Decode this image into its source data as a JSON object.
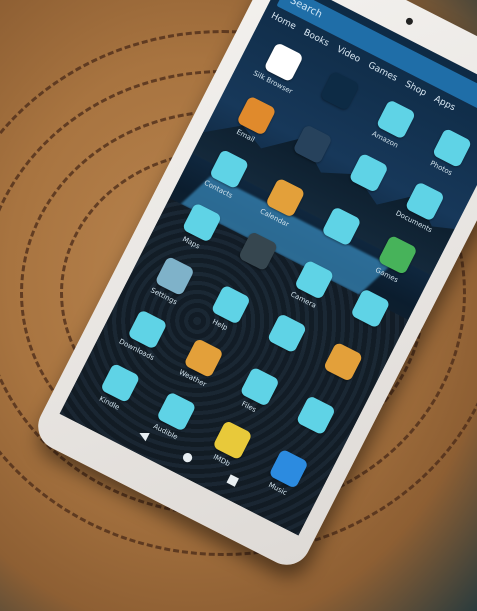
{
  "screen": {
    "search_placeholder": "Search",
    "tabs": [
      "Home",
      "Books",
      "Video",
      "Games",
      "Shop",
      "Apps"
    ],
    "apps": [
      {
        "label": "Silk Browser",
        "color": "#ffffff"
      },
      {
        "label": "",
        "color": "#0d2b45"
      },
      {
        "label": "Amazon",
        "color": "#5fd3e6"
      },
      {
        "label": "Photos",
        "color": "#5fd3e6"
      },
      {
        "label": "Email",
        "color": "#e08a2c"
      },
      {
        "label": "",
        "color": "#27425c"
      },
      {
        "label": "",
        "color": "#5fd3e6"
      },
      {
        "label": "Documents",
        "color": "#5fd3e6"
      },
      {
        "label": "Contacts",
        "color": "#5fd3e6"
      },
      {
        "label": "Calendar",
        "color": "#e3a03a"
      },
      {
        "label": "",
        "color": "#5fd3e6"
      },
      {
        "label": "Games",
        "color": "#47b35a"
      },
      {
        "label": "Maps",
        "color": "#5fd3e6"
      },
      {
        "label": "",
        "color": "#36464f"
      },
      {
        "label": "Camera",
        "color": "#5fd3e6"
      },
      {
        "label": "",
        "color": "#5fd3e6"
      },
      {
        "label": "Settings",
        "color": "#7fb2c9"
      },
      {
        "label": "Help",
        "color": "#5fd3e6"
      },
      {
        "label": "",
        "color": "#5fd3e6"
      },
      {
        "label": "",
        "color": "#e3a03a"
      },
      {
        "label": "Downloads",
        "color": "#5fd3e6"
      },
      {
        "label": "Weather",
        "color": "#e3a03a"
      },
      {
        "label": "Files",
        "color": "#5fd3e6"
      },
      {
        "label": "",
        "color": "#5fd3e6"
      },
      {
        "label": "Kindle",
        "color": "#5fd3e6"
      },
      {
        "label": "Audible",
        "color": "#5fd3e6"
      },
      {
        "label": "IMDb",
        "color": "#e8c93a"
      },
      {
        "label": "Music",
        "color": "#2c8be0"
      }
    ],
    "nav": {
      "back": "◀",
      "home": "●",
      "recents": "■"
    }
  },
  "colors": {
    "mat": "#a87440",
    "tablet_frame": "#f0eeeb",
    "accent": "#1f6ea8"
  }
}
